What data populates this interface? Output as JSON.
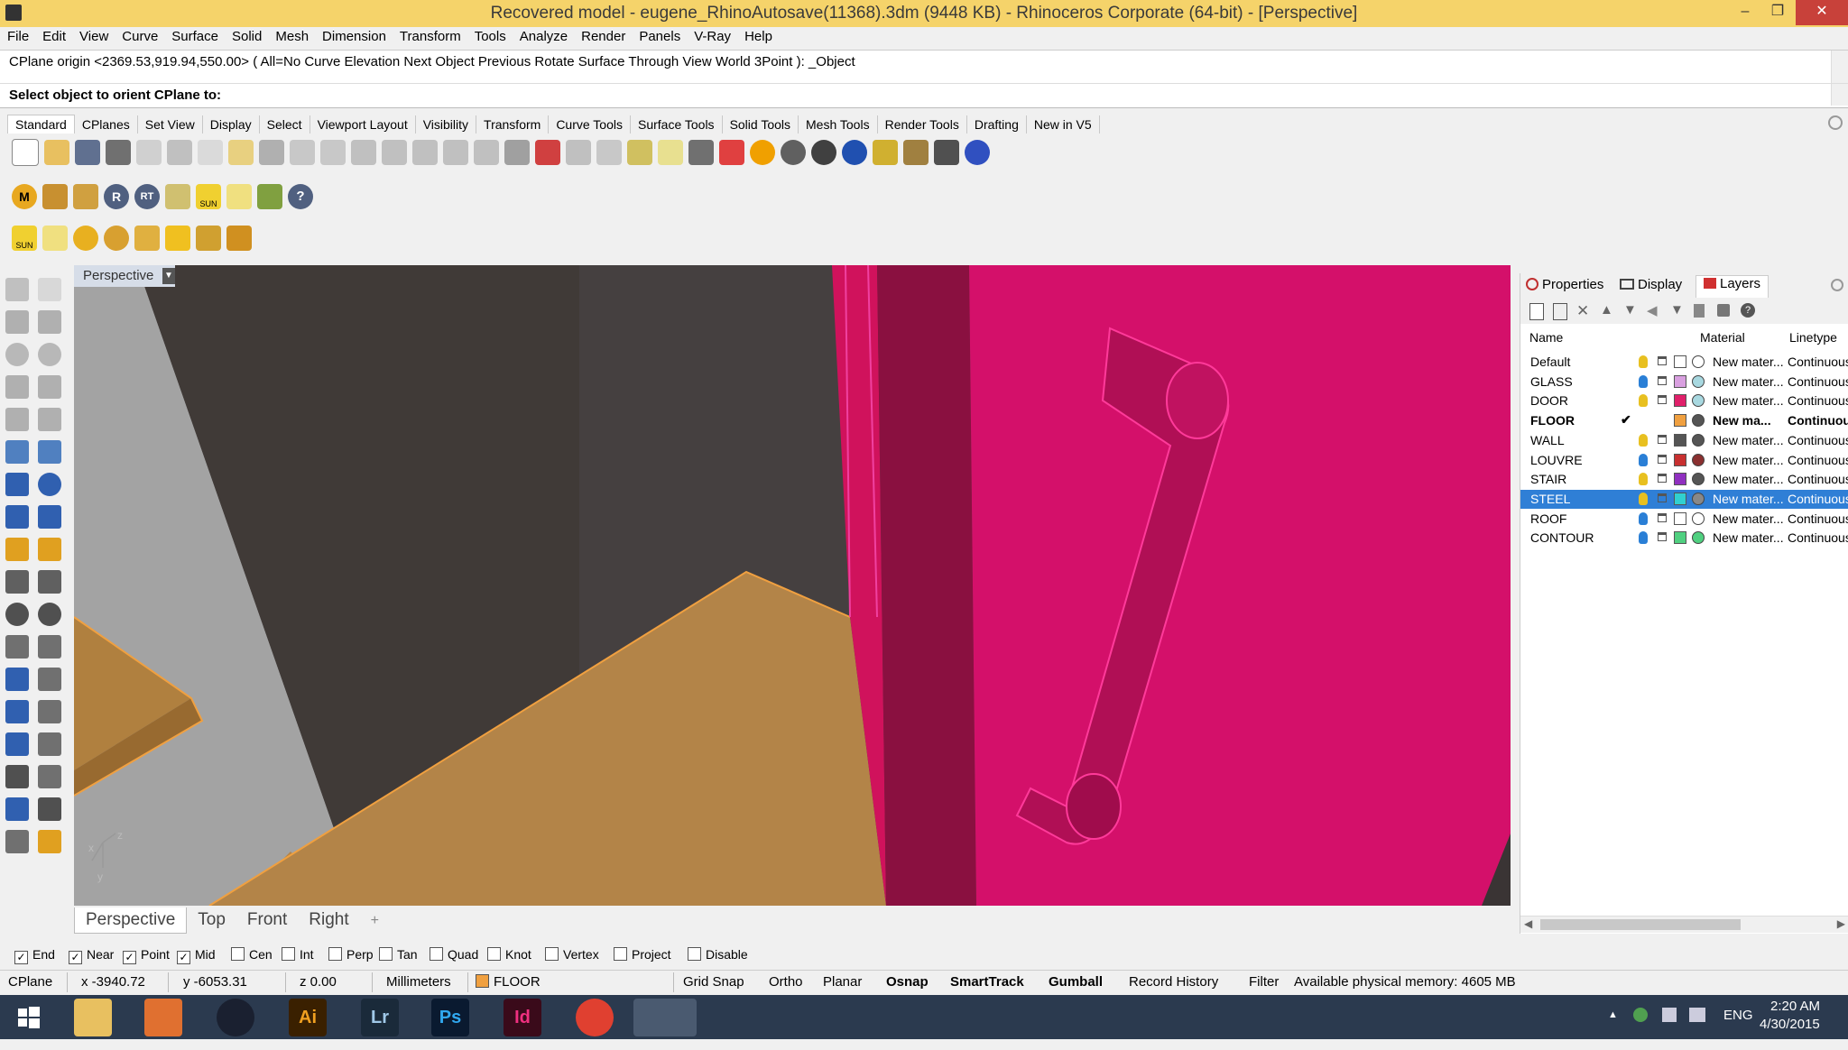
{
  "window": {
    "title": "Recovered model - eugene_RhinoAutosave(11368).3dm (9448 KB) - Rhinoceros Corporate (64-bit) - [Perspective]",
    "minimize": "–",
    "restore": "❐",
    "close": "✕"
  },
  "menu": [
    "File",
    "Edit",
    "View",
    "Curve",
    "Surface",
    "Solid",
    "Mesh",
    "Dimension",
    "Transform",
    "Tools",
    "Analyze",
    "Render",
    "Panels",
    "V-Ray",
    "Help"
  ],
  "command": {
    "history": "CPlane origin <2369.53,919.94,550.00> ( All=No  Curve  Elevation  Next  Object  Previous  Rotate  Surface  Through  View  World  3Point ): _Object",
    "prompt": "Select object to orient CPlane to:"
  },
  "toolbar_tabs": [
    "Standard",
    "CPlanes",
    "Set View",
    "Display",
    "Select",
    "Viewport Layout",
    "Visibility",
    "Transform",
    "Curve Tools",
    "Surface Tools",
    "Solid Tools",
    "Mesh Tools",
    "Render Tools",
    "Drafting",
    "New in V5"
  ],
  "vray_icons": {
    "m": "M",
    "r": "R",
    "rt": "RT",
    "sun": "SUN",
    "help": "?"
  },
  "row3_sun": "SUN",
  "viewport": {
    "label": "Perspective",
    "dropdown": "▼",
    "axis_x": "x",
    "axis_z": "z",
    "axis_y": "y"
  },
  "view_tabs": [
    "Perspective",
    "Top",
    "Front",
    "Right"
  ],
  "view_tab_add": "+",
  "osnap": [
    {
      "label": "End",
      "checked": true
    },
    {
      "label": "Near",
      "checked": true
    },
    {
      "label": "Point",
      "checked": true
    },
    {
      "label": "Mid",
      "checked": true
    },
    {
      "label": "Cen",
      "checked": false
    },
    {
      "label": "Int",
      "checked": false
    },
    {
      "label": "Perp",
      "checked": false
    },
    {
      "label": "Tan",
      "checked": false
    },
    {
      "label": "Quad",
      "checked": false
    },
    {
      "label": "Knot",
      "checked": false
    },
    {
      "label": "Vertex",
      "checked": false
    },
    {
      "label": "Project",
      "checked": false
    },
    {
      "label": "Disable",
      "checked": false
    }
  ],
  "status": {
    "cplane": "CPlane",
    "x": "x -3940.72",
    "y": "y -6053.31",
    "z": "z 0.00",
    "units": "Millimeters",
    "layer": "FLOOR",
    "grid_snap": "Grid Snap",
    "ortho": "Ortho",
    "planar": "Planar",
    "osnap": "Osnap",
    "smarttrack": "SmartTrack",
    "gumball": "Gumball",
    "record_history": "Record History",
    "filter": "Filter",
    "memory": "Available physical memory: 4605 MB"
  },
  "panel": {
    "tabs": [
      "Properties",
      "Display",
      "Layers"
    ],
    "columns": {
      "name": "Name",
      "material": "Material",
      "linetype": "Linetype"
    },
    "layers": [
      {
        "name": "Default",
        "current": false,
        "selected": false,
        "color": "#ffffff",
        "bulb": "#e8c020",
        "matcolor": "#ffffff",
        "material": "New mater...",
        "linetype": "Continuous"
      },
      {
        "name": "GLASS",
        "current": false,
        "selected": false,
        "color": "#d9a0e0",
        "bulb": "#2a7fd6",
        "matcolor": "#a8d8e0",
        "material": "New mater...",
        "linetype": "Continuous"
      },
      {
        "name": "DOOR",
        "current": false,
        "selected": false,
        "color": "#e0206a",
        "bulb": "#e8c020",
        "matcolor": "#a8d8e0",
        "material": "New mater...",
        "linetype": "Continuous"
      },
      {
        "name": "FLOOR",
        "current": true,
        "selected": false,
        "color": "#f0a040",
        "bulb": "",
        "matcolor": "#555555",
        "material": "New ma...",
        "linetype": "Continuous"
      },
      {
        "name": "WALL",
        "current": false,
        "selected": false,
        "color": "#555555",
        "bulb": "#e8c020",
        "matcolor": "#555555",
        "material": "New mater...",
        "linetype": "Continuous"
      },
      {
        "name": "LOUVRE",
        "current": false,
        "selected": false,
        "color": "#c83030",
        "bulb": "#2a7fd6",
        "matcolor": "#8a3030",
        "material": "New mater...",
        "linetype": "Continuous"
      },
      {
        "name": "STAIR",
        "current": false,
        "selected": false,
        "color": "#9030c0",
        "bulb": "#e8c020",
        "matcolor": "#555555",
        "material": "New mater...",
        "linetype": "Continuous"
      },
      {
        "name": "STEEL",
        "current": false,
        "selected": true,
        "color": "#30d0d0",
        "bulb": "#e8c020",
        "matcolor": "#888888",
        "material": "New mater...",
        "linetype": "Continuous"
      },
      {
        "name": "ROOF",
        "current": false,
        "selected": false,
        "color": "#ffffff",
        "bulb": "#2a7fd6",
        "matcolor": "#ffffff",
        "material": "New mater...",
        "linetype": "Continuous"
      },
      {
        "name": "CONTOUR",
        "current": false,
        "selected": false,
        "color": "#50d080",
        "bulb": "#2a7fd6",
        "matcolor": "#50d080",
        "material": "New mater...",
        "linetype": "Continuous"
      }
    ]
  },
  "taskbar": {
    "ai": "Ai",
    "lr": "Lr",
    "ps": "Ps",
    "id": "Id",
    "lang": "ENG",
    "time": "2:20 AM",
    "date": "4/30/2015"
  }
}
